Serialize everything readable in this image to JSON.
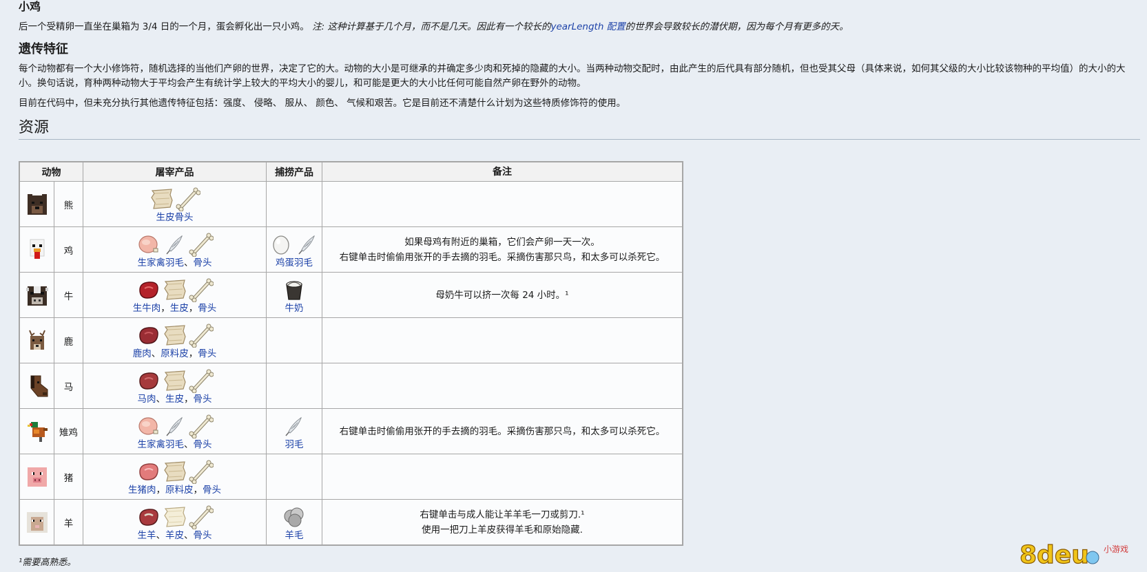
{
  "chick": {
    "heading": "小鸡",
    "text": "后一个受精卵一直坐在巢箱为 3/4 日的一个月，蛋会孵化出一只小鸡。",
    "note_prefix": "注:  这种计算基于几个月，而不是几天。因此有一个较长的",
    "note_link": "yearLength 配置",
    "note_suffix": "的世界会导致较长的潜伏期，因为每个月有更多的天。"
  },
  "genetics": {
    "heading": "遗传特征",
    "para1": "每个动物都有一个大小修饰符，随机选择的当他们产卵的世界，决定了它的大。动物的大小是可继承的并确定多少肉和死掉的隐藏的大小。当两种动物交配时，由此产生的后代具有部分随机，但也受其父母（具体来说，如何其父级的大小比较该物种的平均值）的大小的大小。换句话说，育种两种动物大于平均会产生有统计学上较大的平均大小的婴儿，和可能是更大的大小比任何可能自然产卵在野外的动物。",
    "para2": "目前在代码中，但未充分执行其他遗传特征包括：强度、 侵略、 服从、 颜色、 气候和艰苦。它是目前还不清楚什么计划为这些特质修饰符的使用。"
  },
  "resources": {
    "heading": "资源",
    "columns": [
      "动物",
      "屠宰产品",
      "捕捞产品",
      "备注"
    ],
    "rows": [
      {
        "animal": "熊",
        "icon": "bear-icon",
        "drop_items": [
          "hide-icon",
          "bone-icon"
        ],
        "drop_labels": [
          "生皮",
          "骨头"
        ],
        "drop_seps": [
          ""
        ],
        "coll_items": [],
        "coll_labels": [],
        "notes": []
      },
      {
        "animal": "鸡",
        "icon": "chicken-icon",
        "drop_items": [
          "raw-poultry-icon",
          "feather-icon",
          "bone-icon"
        ],
        "drop_labels": [
          "生家禽",
          "羽毛",
          "骨头"
        ],
        "drop_seps": [
          "",
          "、"
        ],
        "coll_items": [
          "egg-icon",
          "feather-icon"
        ],
        "coll_labels": [
          "鸡蛋",
          "羽毛"
        ],
        "notes": [
          "如果母鸡有附近的巢箱，它们会产卵一天一次。",
          "右键单击时偷偷用张开的手去摘的羽毛。采摘伤害那只鸟，和太多可以杀死它。"
        ]
      },
      {
        "animal": "牛",
        "icon": "cow-icon",
        "drop_items": [
          "raw-beef-icon",
          "hide-icon",
          "bone-icon"
        ],
        "drop_labels": [
          "生牛肉",
          "生皮",
          "骨头"
        ],
        "drop_seps": [
          "，",
          "，"
        ],
        "coll_items": [
          "milk-bucket-icon"
        ],
        "coll_labels": [
          "牛奶"
        ],
        "notes": [
          "母奶牛可以挤一次每 24 小时。¹"
        ]
      },
      {
        "animal": "鹿",
        "icon": "deer-icon",
        "drop_items": [
          "raw-venison-icon",
          "hide-icon",
          "bone-icon"
        ],
        "drop_labels": [
          "鹿肉",
          "原料皮",
          "骨头"
        ],
        "drop_seps": [
          "、",
          "，"
        ],
        "coll_items": [],
        "coll_labels": [],
        "notes": []
      },
      {
        "animal": "马",
        "icon": "horse-icon",
        "drop_items": [
          "raw-horse-meat-icon",
          "hide-icon",
          "bone-icon"
        ],
        "drop_labels": [
          "马肉",
          "生皮",
          "骨头"
        ],
        "drop_seps": [
          "、",
          "，"
        ],
        "coll_items": [],
        "coll_labels": [],
        "notes": []
      },
      {
        "animal": "雉鸡",
        "icon": "pheasant-icon",
        "drop_items": [
          "raw-poultry-icon",
          "feather-icon",
          "bone-icon"
        ],
        "drop_labels": [
          "生家禽",
          "羽毛",
          "骨头"
        ],
        "drop_seps": [
          "",
          "、"
        ],
        "coll_items": [
          "feather-icon"
        ],
        "coll_labels": [
          "羽毛"
        ],
        "notes": [
          "右键单击时偷偷用张开的手去摘的羽毛。采摘伤害那只鸟，和太多可以杀死它。"
        ]
      },
      {
        "animal": "猪",
        "icon": "pig-icon",
        "drop_items": [
          "raw-pork-icon",
          "hide-icon",
          "bone-icon"
        ],
        "drop_labels": [
          "生猪肉",
          "原料皮",
          "骨头"
        ],
        "drop_seps": [
          "，",
          "，"
        ],
        "coll_items": [],
        "coll_labels": [],
        "notes": []
      },
      {
        "animal": "羊",
        "icon": "sheep-icon",
        "drop_items": [
          "raw-mutton-icon",
          "sheepskin-icon",
          "bone-icon"
        ],
        "drop_labels": [
          "生羊",
          "羊皮",
          "骨头"
        ],
        "drop_seps": [
          "、",
          "、"
        ],
        "coll_items": [
          "wool-icon"
        ],
        "coll_labels": [
          "羊毛"
        ],
        "notes": [
          "右键单击与成人能让羊羊毛一刀或剪刀.¹",
          "使用一把刀上羊皮获得羊毛和原始隐藏."
        ]
      }
    ]
  },
  "footnote": "¹需要高熟悉。",
  "watermark": {
    "text": "8deu",
    "sub": "小游戏"
  }
}
